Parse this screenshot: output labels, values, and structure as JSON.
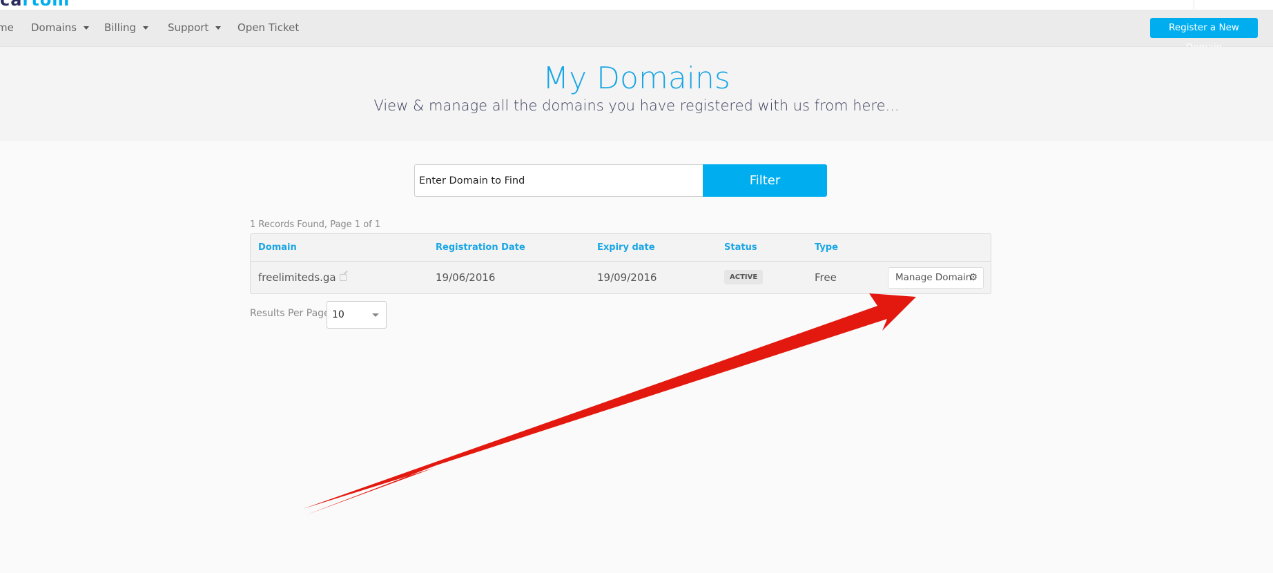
{
  "brand": {
    "logo_part1": "ca",
    "logo_part2": "rtom"
  },
  "nav": {
    "items": [
      {
        "label": "me",
        "has_dropdown": false
      },
      {
        "label": "Domains",
        "has_dropdown": true
      },
      {
        "label": "Billing",
        "has_dropdown": true
      },
      {
        "label": "Support",
        "has_dropdown": true
      },
      {
        "label": "Open Ticket",
        "has_dropdown": false
      }
    ],
    "register_button": "Register a New Domain"
  },
  "hero": {
    "title": "My Domains",
    "subtitle": "View & manage all the domains you have registered with us from here..."
  },
  "search": {
    "value": "Enter Domain to Find",
    "filter_button": "Filter"
  },
  "results": {
    "summary": "1 Records Found, Page 1 of 1",
    "columns": [
      "Domain",
      "Registration Date",
      "Expiry date",
      "Status",
      "Type"
    ],
    "rows": [
      {
        "domain": "freelimiteds.ga",
        "registration_date": "19/06/2016",
        "expiry_date": "19/09/2016",
        "status": "ACTIVE",
        "type": "Free",
        "action": "Manage Domain"
      }
    ],
    "per_page_label": "Results Per Page:",
    "per_page_value": "10"
  },
  "colors": {
    "accent": "#00aeef",
    "annotation_arrow": "#e3190f"
  },
  "icons": {
    "external_link": "external-link-icon",
    "gear": "gear-icon"
  }
}
